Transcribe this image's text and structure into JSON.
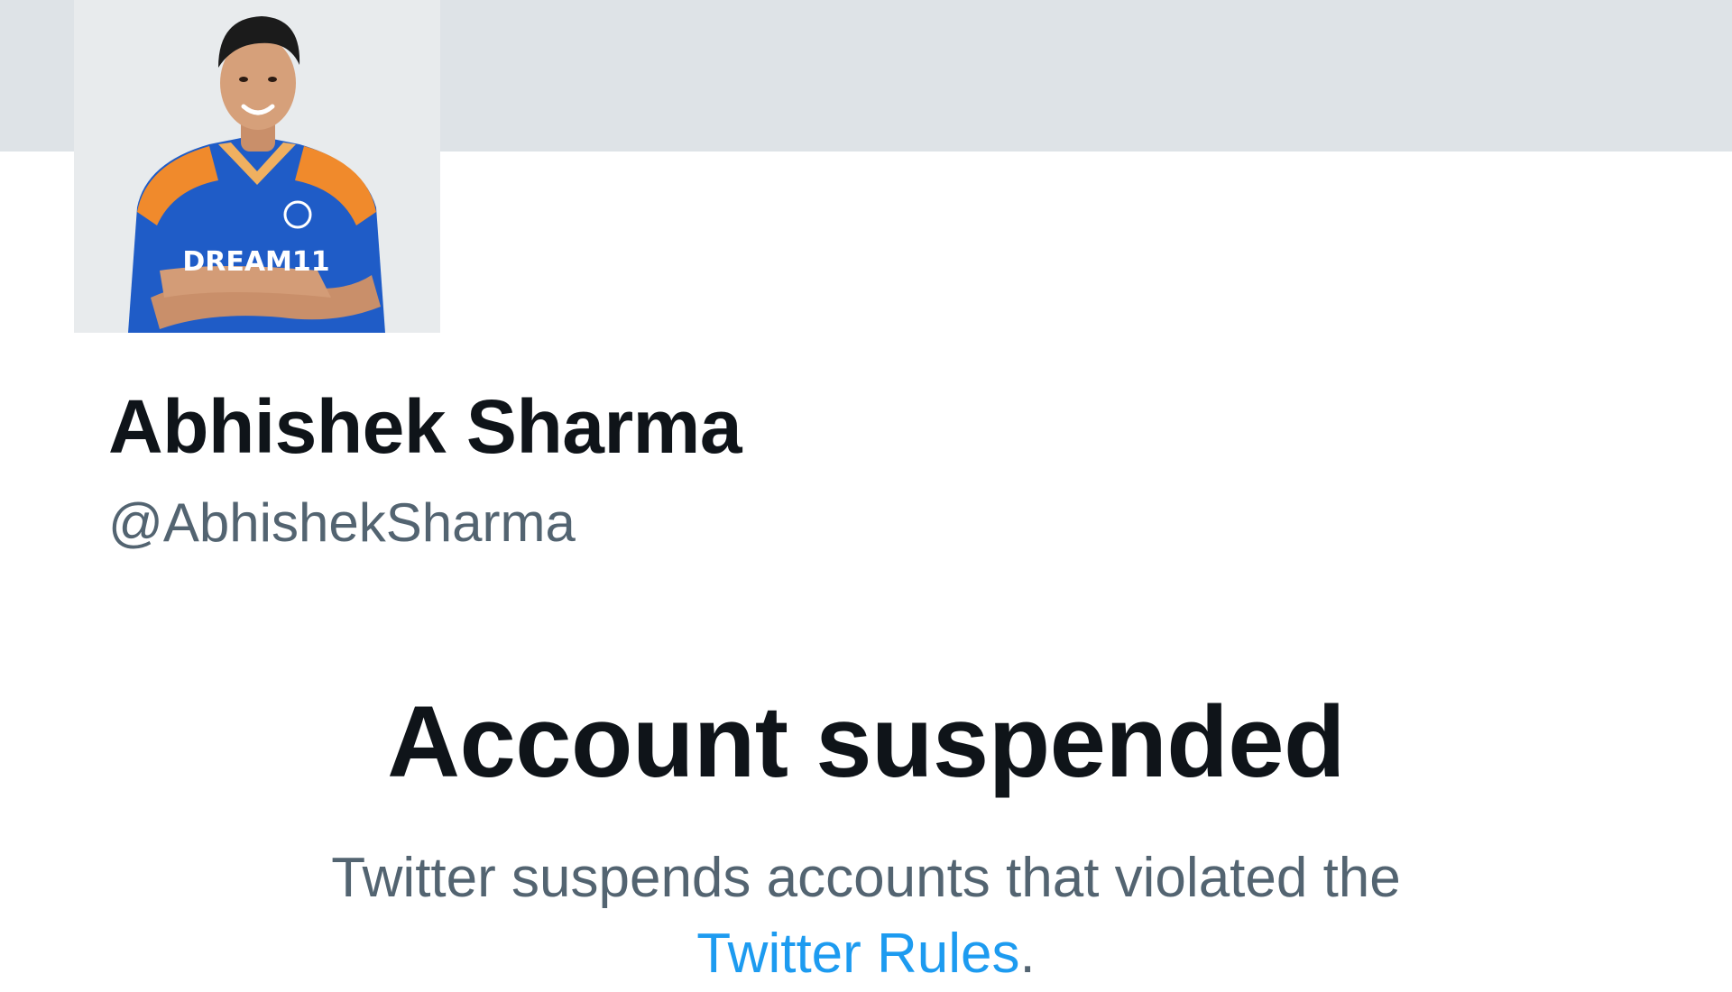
{
  "profile": {
    "display_name": "Abhishek Sharma",
    "handle": "@AbhishekSharma",
    "avatar_jersey_text": "DREAM11"
  },
  "suspension": {
    "title": "Account suspended",
    "message_prefix": "Twitter suspends accounts that violated the",
    "rules_link": "Twitter Rules",
    "message_suffix": "."
  },
  "colors": {
    "banner": "#dee3e7",
    "primary_text": "#0f1419",
    "secondary_text": "#536471",
    "link": "#1d9bf0",
    "jersey_blue": "#1f5cc7",
    "jersey_orange": "#f08a2c"
  }
}
